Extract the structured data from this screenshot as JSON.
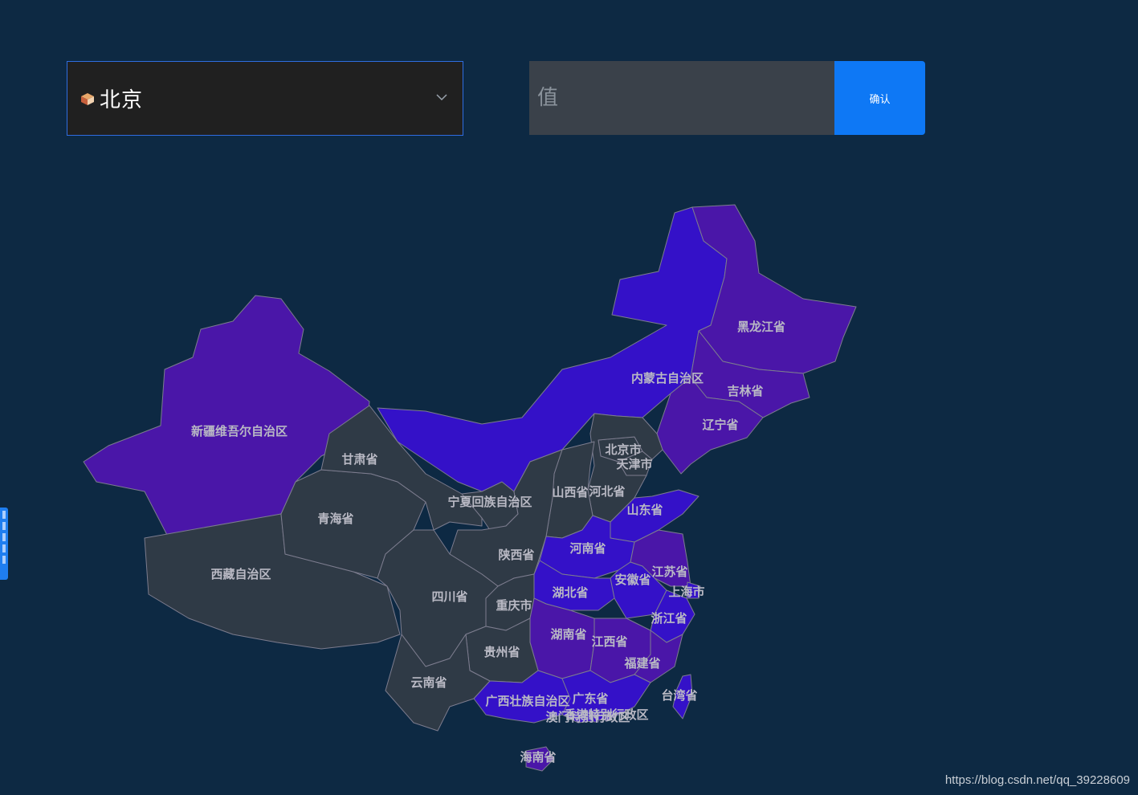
{
  "city_select": {
    "selected": "北京",
    "icon": "city-badge-icon"
  },
  "value_input": {
    "placeholder": "值",
    "value": ""
  },
  "confirm_button": {
    "label": "确认"
  },
  "map_colors": {
    "gray": "#2f3a46",
    "blue": "#3411c8",
    "purple": "#4a16a8"
  },
  "provinces": [
    {
      "name": "新疆维吾尔自治区",
      "fill": "purple"
    },
    {
      "name": "西藏自治区",
      "fill": "gray"
    },
    {
      "name": "青海省",
      "fill": "gray"
    },
    {
      "name": "甘肃省",
      "fill": "gray"
    },
    {
      "name": "内蒙古自治区",
      "fill": "blue"
    },
    {
      "name": "黑龙江省",
      "fill": "purple"
    },
    {
      "name": "吉林省",
      "fill": "purple"
    },
    {
      "name": "辽宁省",
      "fill": "purple"
    },
    {
      "name": "北京市",
      "fill": "gray"
    },
    {
      "name": "天津市",
      "fill": "gray"
    },
    {
      "name": "河北省",
      "fill": "gray"
    },
    {
      "name": "山西省",
      "fill": "gray"
    },
    {
      "name": "宁夏回族自治区",
      "fill": "gray"
    },
    {
      "name": "陕西省",
      "fill": "gray"
    },
    {
      "name": "山东省",
      "fill": "blue"
    },
    {
      "name": "河南省",
      "fill": "blue"
    },
    {
      "name": "江苏省",
      "fill": "purple"
    },
    {
      "name": "安徽省",
      "fill": "blue"
    },
    {
      "name": "上海市",
      "fill": "blue"
    },
    {
      "name": "湖北省",
      "fill": "blue"
    },
    {
      "name": "四川省",
      "fill": "gray"
    },
    {
      "name": "重庆市",
      "fill": "gray"
    },
    {
      "name": "浙江省",
      "fill": "blue"
    },
    {
      "name": "湖南省",
      "fill": "purple"
    },
    {
      "name": "江西省",
      "fill": "purple"
    },
    {
      "name": "福建省",
      "fill": "purple"
    },
    {
      "name": "贵州省",
      "fill": "gray"
    },
    {
      "name": "云南省",
      "fill": "gray"
    },
    {
      "name": "广西壮族自治区",
      "fill": "blue"
    },
    {
      "name": "广东省",
      "fill": "blue"
    },
    {
      "name": "香港特别行政区",
      "fill": "blue"
    },
    {
      "name": "澳门特别行政区",
      "fill": "blue"
    },
    {
      "name": "台湾省",
      "fill": "blue"
    },
    {
      "name": "海南省",
      "fill": "purple"
    }
  ],
  "watermark": "https://blog.csdn.net/qq_39228609"
}
